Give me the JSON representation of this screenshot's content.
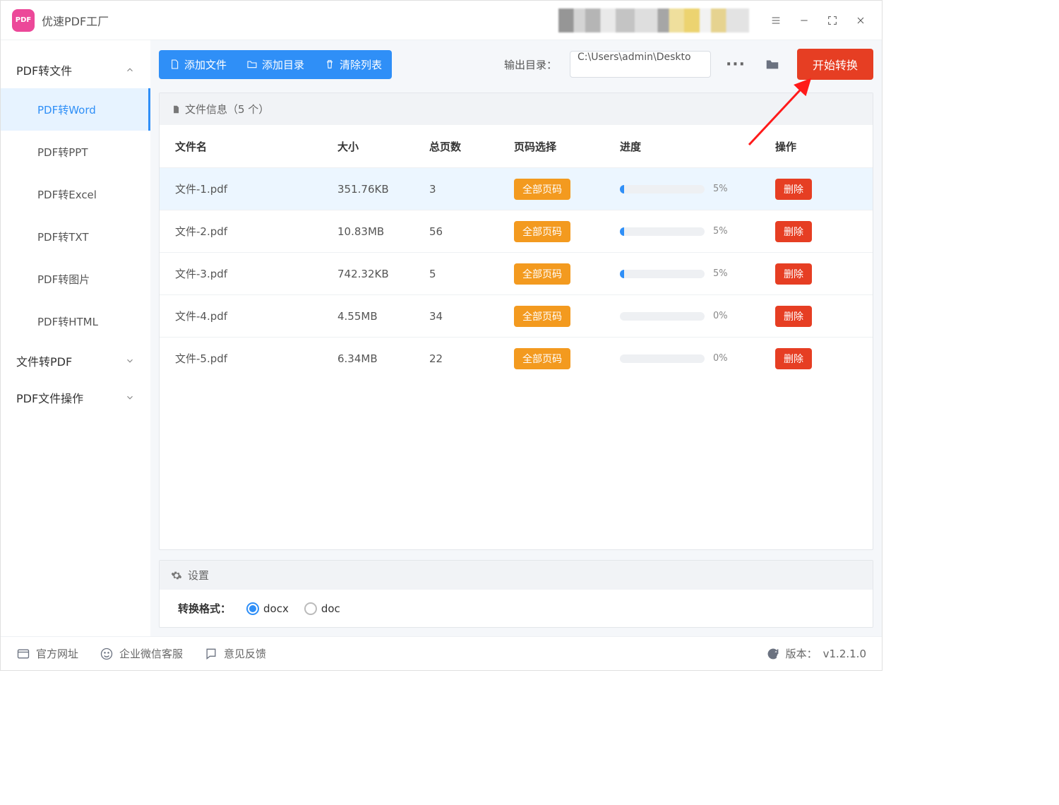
{
  "app_title": "优速PDF工厂",
  "window_controls": {
    "menu": "menu",
    "minimize": "minimize",
    "maximize": "fullscreen",
    "close": "close"
  },
  "sidebar": {
    "groups": [
      {
        "label": "PDF转文件",
        "expanded": true,
        "items": [
          {
            "label": "PDF转Word",
            "active": true
          },
          {
            "label": "PDF转PPT"
          },
          {
            "label": "PDF转Excel"
          },
          {
            "label": "PDF转TXT"
          },
          {
            "label": "PDF转图片"
          },
          {
            "label": "PDF转HTML"
          }
        ]
      },
      {
        "label": "文件转PDF",
        "expanded": false
      },
      {
        "label": "PDF文件操作",
        "expanded": false
      }
    ]
  },
  "toolbar": {
    "add_file": "添加文件",
    "add_dir": "添加目录",
    "clear": "清除列表",
    "outdir_label": "输出目录：",
    "outdir_value": "C:\\Users\\admin\\Deskto",
    "start": "开始转换"
  },
  "panel": {
    "header": "文件信息（5 个）",
    "columns": {
      "name": "文件名",
      "size": "大小",
      "pages": "总页数",
      "range": "页码选择",
      "progress": "进度",
      "action": "操作"
    },
    "range_label": "全部页码",
    "delete_label": "删除",
    "rows": [
      {
        "name": "文件-1.pdf",
        "size": "351.76KB",
        "pages": "3",
        "progress": 5,
        "highlight": true
      },
      {
        "name": "文件-2.pdf",
        "size": "10.83MB",
        "pages": "56",
        "progress": 5
      },
      {
        "name": "文件-3.pdf",
        "size": "742.32KB",
        "pages": "5",
        "progress": 5
      },
      {
        "name": "文件-4.pdf",
        "size": "4.55MB",
        "pages": "34",
        "progress": 0
      },
      {
        "name": "文件-5.pdf",
        "size": "6.34MB",
        "pages": "22",
        "progress": 0
      }
    ]
  },
  "settings": {
    "header": "设置",
    "format_label": "转换格式：",
    "options": [
      {
        "label": "docx",
        "selected": true
      },
      {
        "label": "doc",
        "selected": false
      }
    ]
  },
  "footer": {
    "website": "官方网址",
    "support": "企业微信客服",
    "feedback": "意见反馈",
    "version_label": "版本：",
    "version": "v1.2.1.0"
  }
}
